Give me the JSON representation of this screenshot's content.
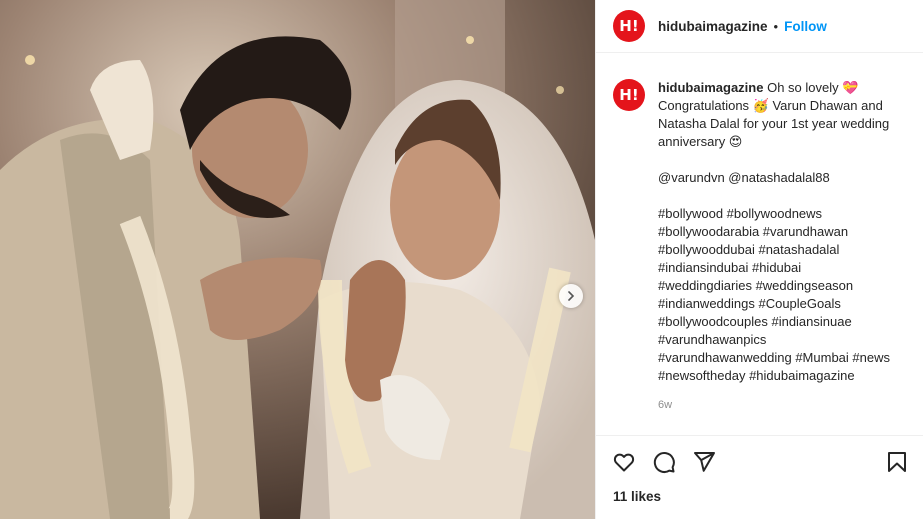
{
  "post": {
    "image_alt": "Couple in wedding attire greeting each other with folded hands"
  },
  "header": {
    "avatar_text": "H!",
    "username": "hidubaimagazine",
    "separator": "•",
    "follow_label": "Follow"
  },
  "caption": {
    "username": "hidubaimagazine",
    "lines": [
      "Oh so lovely 💝",
      "Congratulations 🥳 Varun Dhawan and",
      "Natasha Dalal for your 1st year wedding",
      "anniversary 😍",
      "",
      "@varundvn @natashadalal88",
      "",
      "#bollywood #bollywoodnews",
      "#bollywoodarabia #varundhawan",
      "#bollywooddubai #natashadalal",
      "#indiansindubai #hidubai",
      "#weddingdiaries #weddingseason",
      "#indianweddings #CoupleGoals",
      "#bollywoodcouples #indiansinuae",
      "#varundhawanpics",
      "#varundhawanwedding #Mumbai #news",
      "#newsoftheday #hidubaimagazine"
    ],
    "time": "6w"
  },
  "actions": {
    "likes": "11 likes"
  },
  "colors": {
    "brand_red": "#e4141b",
    "follow_blue": "#0095f6",
    "muted": "#8e8e8e"
  },
  "icons": [
    "heart-icon",
    "comment-icon",
    "share-icon",
    "bookmark-icon",
    "chevron-right-icon"
  ]
}
